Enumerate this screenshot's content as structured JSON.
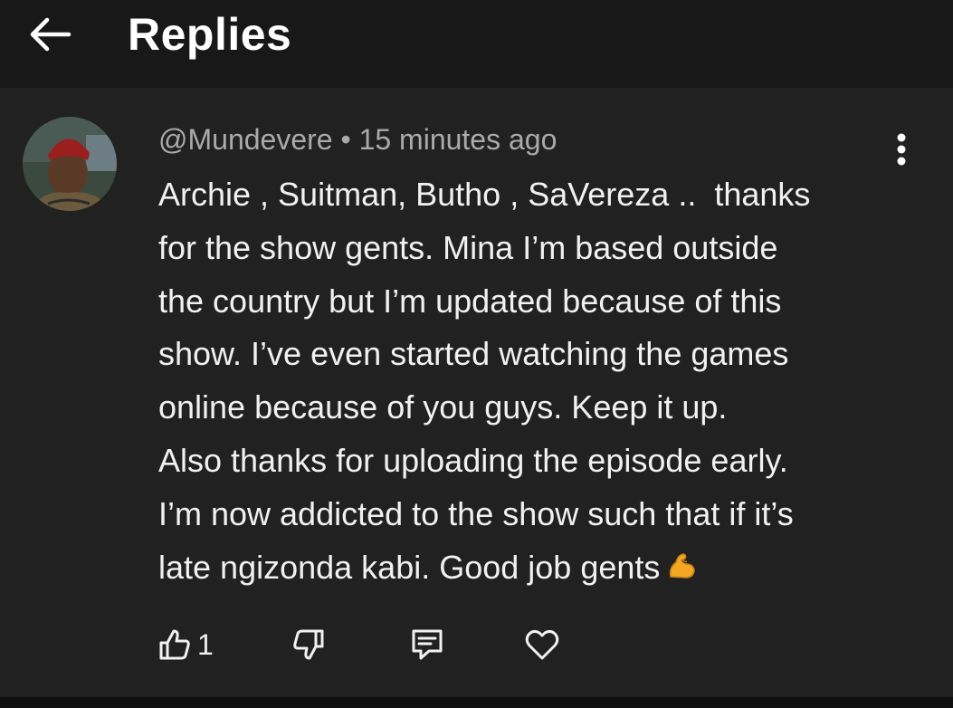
{
  "header": {
    "title": "Replies",
    "back_icon": "arrow-left-icon"
  },
  "comment": {
    "author": "@Mundevere",
    "separator": "•",
    "time": "15 minutes ago",
    "text_lines": [
      "Archie , Suitman, Butho , SaVereza ..  thanks",
      "for the show gents. Mina I’m based outside",
      "the country but I’m updated because of this",
      "show. I’ve even started watching the games",
      "online because of you guys. Keep it up.",
      "Also thanks for uploading the episode early.",
      "I’m now addicted to the show such that if it’s",
      "late ngizonda kabi. Good job gents"
    ],
    "emoji": "flexed-biceps",
    "like_count": "1"
  },
  "actions": {
    "like_icon": "thumbs-up-icon",
    "dislike_icon": "thumbs-down-icon",
    "reply_icon": "comment-icon",
    "heart_icon": "heart-icon"
  }
}
